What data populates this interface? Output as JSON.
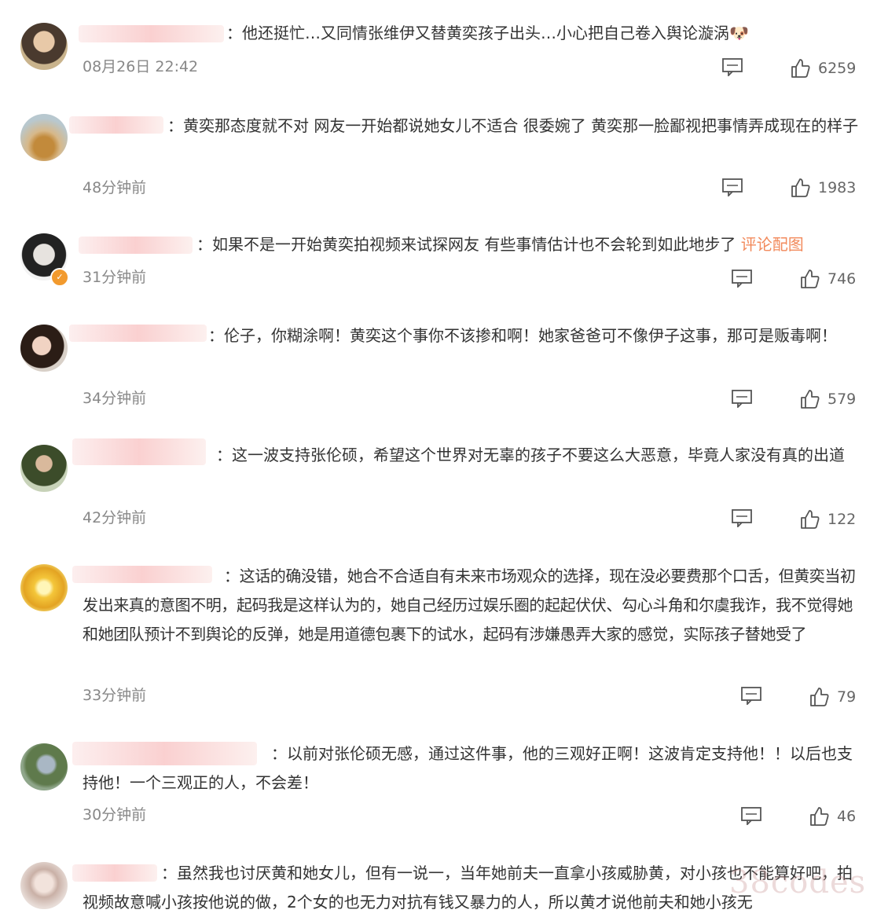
{
  "comments": [
    {
      "text": "：他还挺忙…又同情张维伊又替黄奕孩子出头…小心把自己卷入舆论漩涡",
      "emoji": "🐶",
      "time": "08月26日 22:42",
      "likes": "6259"
    },
    {
      "text": "：黄奕那态度就不对 网友一开始都说她女儿不适合 很委婉了 黄奕那一脸鄙视把事情弄成现在的样子",
      "time": "48分钟前",
      "likes": "1983"
    },
    {
      "text": "：如果不是一开始黄奕拍视频来试探网友 有些事情估计也不会轮到如此地步了",
      "link": "评论配图",
      "time": "31分钟前",
      "likes": "746"
    },
    {
      "text": "：伦子，你糊涂啊！黄奕这个事你不该掺和啊！她家爸爸可不像伊子这事，那可是贩毒啊！",
      "time": "34分钟前",
      "likes": "579"
    },
    {
      "text": "：这一波支持张伦硕，希望这个世界对无辜的孩子不要这么大恶意，毕竟人家没有真的出道",
      "time": "42分钟前",
      "likes": "122"
    },
    {
      "text": "：这话的确没错，她合不合适自有未来市场观众的选择，现在没必要费那个口舌，但黄奕当初发出来真的意图不明，起码我是这样认为的，她自己经历过娱乐圈的起起伏伏、勾心斗角和尔虞我诈，我不觉得她和她团队预计不到舆论的反弹，她是用道德包裹下的试水，起码有涉嫌愚弄大家的感觉，实际孩子替她受了",
      "time": "33分钟前",
      "likes": "79"
    },
    {
      "text": "：以前对张伦硕无感，通过这件事，他的三观好正啊！这波肯定支持他！！以后也支持他！一个三观正的人，不会差！",
      "time": "30分钟前",
      "likes": "46"
    },
    {
      "text": "：虽然我也讨厌黄和她女儿，但有一说一，当年她前夫一直拿小孩威胁黄，对小孩也不能算好吧，拍视频故意喊小孩按他说的做，2个女的也无力对抗有钱又暴力的人，所以黄才说他前夫和她小孩无"
    }
  ],
  "watermark": "38codes",
  "colors": {
    "link": "#f28a5c",
    "meta": "#888888",
    "icon": "#555555"
  }
}
